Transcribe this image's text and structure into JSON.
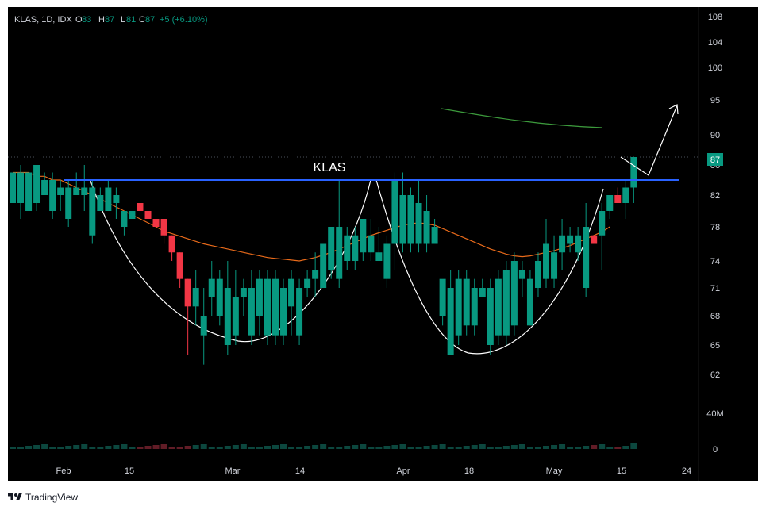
{
  "legend": {
    "symbol": "KLAS, 1D, IDX",
    "open_label": "O",
    "open": "83",
    "high_label": "H",
    "high": "87",
    "low_label": "L",
    "low": "81",
    "close_label": "C",
    "close": "87",
    "change": "+5 (+6.10%)"
  },
  "footer": {
    "brand": "TradingView"
  },
  "colors": {
    "up": "#089981",
    "down": "#f23645",
    "background": "#000000",
    "resistance": "#2962ff",
    "ma_orange": "#e86a1a",
    "ma_green": "#3c9a3c",
    "cup_curve": "#ffffff",
    "last_price_bg": "#089981"
  },
  "chart_data": {
    "type": "candlestick",
    "title": "KLAS",
    "yaxis_ticks": [
      "108",
      "104",
      "100",
      "95",
      "90",
      "87",
      "86",
      "82",
      "78",
      "74",
      "71",
      "68",
      "65",
      "62"
    ],
    "volume_ticks": [
      "40M",
      "0"
    ],
    "xaxis_ticks": [
      "Feb",
      "15",
      "Mar",
      "14",
      "Apr",
      "18",
      "May",
      "15",
      "24"
    ],
    "last_price": "87",
    "resistance_level": 84,
    "candles": [
      {
        "o": 81,
        "h": 85,
        "l": 81,
        "c": 85
      },
      {
        "o": 81,
        "h": 86,
        "l": 79,
        "c": 85
      },
      {
        "o": 80,
        "h": 85,
        "l": 80,
        "c": 85
      },
      {
        "o": 81,
        "h": 86,
        "l": 80,
        "c": 86
      },
      {
        "o": 82,
        "h": 85,
        "l": 82,
        "c": 84
      },
      {
        "o": 80,
        "h": 85,
        "l": 79,
        "c": 84
      },
      {
        "o": 82,
        "h": 84,
        "l": 80,
        "c": 83
      },
      {
        "o": 79,
        "h": 84,
        "l": 78,
        "c": 83
      },
      {
        "o": 82,
        "h": 85,
        "l": 82,
        "c": 83
      },
      {
        "o": 82,
        "h": 86,
        "l": 80,
        "c": 83
      },
      {
        "o": 77,
        "h": 84,
        "l": 76,
        "c": 83
      },
      {
        "o": 80,
        "h": 83,
        "l": 80,
        "c": 82
      },
      {
        "o": 80,
        "h": 84,
        "l": 80,
        "c": 83
      },
      {
        "o": 81,
        "h": 83,
        "l": 79,
        "c": 82
      },
      {
        "o": 78,
        "h": 80,
        "l": 77,
        "c": 80
      },
      {
        "o": 79,
        "h": 80,
        "l": 79,
        "c": 80
      },
      {
        "o": 81,
        "h": 81,
        "l": 79,
        "c": 80
      },
      {
        "o": 80,
        "h": 80,
        "l": 78,
        "c": 79
      },
      {
        "o": 79,
        "h": 79,
        "l": 78,
        "c": 78
      },
      {
        "o": 79,
        "h": 79,
        "l": 76,
        "c": 77
      },
      {
        "o": 77,
        "h": 77,
        "l": 74,
        "c": 75
      },
      {
        "o": 75,
        "h": 75,
        "l": 71,
        "c": 72
      },
      {
        "o": 72,
        "h": 72,
        "l": 64,
        "c": 69
      },
      {
        "o": 69,
        "h": 73,
        "l": 67,
        "c": 71
      },
      {
        "o": 66,
        "h": 71,
        "l": 63,
        "c": 68
      },
      {
        "o": 70,
        "h": 74,
        "l": 68,
        "c": 72
      },
      {
        "o": 68,
        "h": 73,
        "l": 67,
        "c": 72
      },
      {
        "o": 65,
        "h": 74,
        "l": 64,
        "c": 71
      },
      {
        "o": 66,
        "h": 73,
        "l": 65,
        "c": 70
      },
      {
        "o": 70,
        "h": 72,
        "l": 68,
        "c": 71
      },
      {
        "o": 66,
        "h": 73,
        "l": 65,
        "c": 71
      },
      {
        "o": 68,
        "h": 73,
        "l": 66,
        "c": 72
      },
      {
        "o": 66,
        "h": 73,
        "l": 65,
        "c": 72
      },
      {
        "o": 66,
        "h": 73,
        "l": 65,
        "c": 72
      },
      {
        "o": 66,
        "h": 72,
        "l": 65,
        "c": 71
      },
      {
        "o": 69,
        "h": 73,
        "l": 66,
        "c": 72
      },
      {
        "o": 66,
        "h": 72,
        "l": 65,
        "c": 71
      },
      {
        "o": 71,
        "h": 73,
        "l": 70,
        "c": 72
      },
      {
        "o": 72,
        "h": 75,
        "l": 70,
        "c": 73
      },
      {
        "o": 71,
        "h": 76,
        "l": 71,
        "c": 76
      },
      {
        "o": 73,
        "h": 78,
        "l": 72,
        "c": 78
      },
      {
        "o": 72,
        "h": 84,
        "l": 71,
        "c": 78
      },
      {
        "o": 74,
        "h": 78,
        "l": 73,
        "c": 77
      },
      {
        "o": 74,
        "h": 78,
        "l": 73,
        "c": 77
      },
      {
        "o": 75,
        "h": 79,
        "l": 74,
        "c": 79
      },
      {
        "o": 75,
        "h": 79,
        "l": 74,
        "c": 77
      },
      {
        "o": 74,
        "h": 78,
        "l": 74,
        "c": 75
      },
      {
        "o": 72,
        "h": 77,
        "l": 71,
        "c": 76
      },
      {
        "o": 76,
        "h": 85,
        "l": 73,
        "c": 84
      },
      {
        "o": 76,
        "h": 85,
        "l": 75,
        "c": 82
      },
      {
        "o": 76,
        "h": 83,
        "l": 75,
        "c": 82
      },
      {
        "o": 76,
        "h": 84,
        "l": 75,
        "c": 81
      },
      {
        "o": 76,
        "h": 82,
        "l": 75,
        "c": 80
      },
      {
        "o": 76,
        "h": 79,
        "l": 76,
        "c": 78
      },
      {
        "o": 68,
        "h": 71,
        "l": 67,
        "c": 72
      },
      {
        "o": 64,
        "h": 73,
        "l": 64,
        "c": 71
      },
      {
        "o": 66,
        "h": 73,
        "l": 65,
        "c": 72
      },
      {
        "o": 67,
        "h": 73,
        "l": 66,
        "c": 72
      },
      {
        "o": 67,
        "h": 72,
        "l": 66,
        "c": 71
      },
      {
        "o": 70,
        "h": 72,
        "l": 70,
        "c": 71
      },
      {
        "o": 65,
        "h": 72,
        "l": 64,
        "c": 71
      },
      {
        "o": 66,
        "h": 73,
        "l": 65,
        "c": 72
      },
      {
        "o": 66,
        "h": 74,
        "l": 65,
        "c": 73
      },
      {
        "o": 67,
        "h": 75,
        "l": 66,
        "c": 74
      },
      {
        "o": 72,
        "h": 74,
        "l": 70,
        "c": 73
      },
      {
        "o": 67,
        "h": 73,
        "l": 67,
        "c": 72
      },
      {
        "o": 71,
        "h": 75,
        "l": 70,
        "c": 74
      },
      {
        "o": 72,
        "h": 79,
        "l": 71,
        "c": 76
      },
      {
        "o": 72,
        "h": 77,
        "l": 71,
        "c": 75
      },
      {
        "o": 75,
        "h": 79,
        "l": 73,
        "c": 77
      },
      {
        "o": 76,
        "h": 78,
        "l": 75,
        "c": 77
      },
      {
        "o": 75,
        "h": 78,
        "l": 74,
        "c": 77
      },
      {
        "o": 71,
        "h": 81,
        "l": 70,
        "c": 78
      },
      {
        "o": 77,
        "h": 77,
        "l": 76,
        "c": 76
      },
      {
        "o": 77,
        "h": 81,
        "l": 73,
        "c": 80
      },
      {
        "o": 80,
        "h": 82,
        "l": 79,
        "c": 82
      },
      {
        "o": 82,
        "h": 83,
        "l": 81,
        "c": 81
      },
      {
        "o": 81,
        "h": 84,
        "l": 79,
        "c": 83
      },
      {
        "o": 83,
        "h": 87,
        "l": 81,
        "c": 87
      }
    ],
    "ma_orange": [
      85,
      85,
      85,
      84.5,
      84.5,
      84,
      84,
      83.5,
      83,
      82.5,
      82,
      81.5,
      81,
      80.5,
      80,
      79.5,
      79,
      78.5,
      78,
      77.5,
      77.2,
      76.9,
      76.6,
      76.3,
      76,
      75.8,
      75.6,
      75.4,
      75.2,
      75,
      74.8,
      74.6,
      74.4,
      74.3,
      74.2,
      74.1,
      74,
      74.2,
      74.4,
      74.7,
      75,
      75.4,
      75.8,
      76.2,
      76.6,
      77,
      77.3,
      77.6,
      77.9,
      78.2,
      78.4,
      78.5,
      78.4,
      78.2,
      77.8,
      77.4,
      77,
      76.6,
      76.2,
      75.8,
      75.4,
      75.1,
      74.8,
      74.6,
      74.5,
      74.6,
      74.8,
      75,
      75.2,
      75.5,
      75.8,
      76.2,
      76.6,
      77,
      77.4,
      78
    ]
  }
}
